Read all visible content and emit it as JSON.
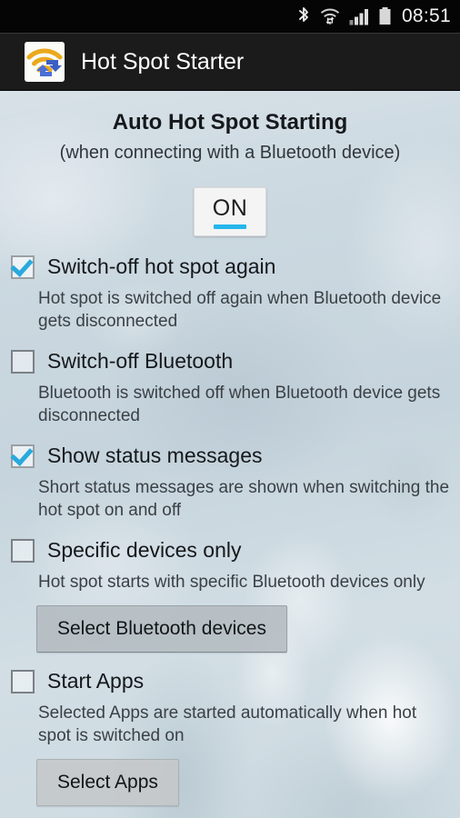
{
  "status_bar": {
    "time": "08:51",
    "icons": [
      "bluetooth-icon",
      "wifi-icon",
      "cellular-signal-icon",
      "battery-icon"
    ]
  },
  "action_bar": {
    "app_title": "Hot Spot Starter",
    "app_icon": "hotspot-app-icon"
  },
  "main": {
    "title": "Auto Hot Spot Starting",
    "subtitle": "(when connecting with a Bluetooth device)",
    "toggle": {
      "label": "ON",
      "state": "on",
      "accent_color": "#25b6ec"
    },
    "options": [
      {
        "label": "Switch-off hot spot again",
        "checked": true,
        "description": "Hot spot is switched off again when Bluetooth device gets disconnected"
      },
      {
        "label": "Switch-off Bluetooth",
        "checked": false,
        "description": "Bluetooth is switched off when Bluetooth device gets disconnected"
      },
      {
        "label": "Show status messages",
        "checked": true,
        "description": "Short status messages are shown when switching the hot spot on and off"
      },
      {
        "label": "Specific devices only",
        "checked": false,
        "description": "Hot spot starts with specific Bluetooth devices only",
        "button": "Select Bluetooth devices"
      },
      {
        "label": "Start Apps",
        "checked": false,
        "description": "Selected Apps are started automatically when hot spot is switched on",
        "button": "Select Apps"
      }
    ]
  },
  "colors": {
    "accent": "#25b6ec",
    "checkmark": "#29a9dd",
    "action_bar_bg": "#1b1b1b",
    "status_bar_bg": "#050505"
  }
}
